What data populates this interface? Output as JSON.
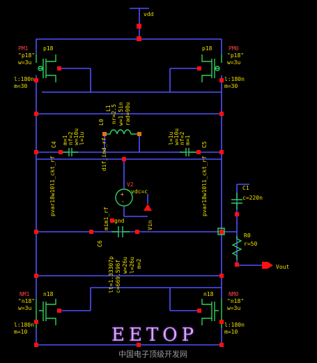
{
  "colors": {
    "background": "#000000",
    "wire": "#5050ff",
    "device": "#30d060",
    "label": "#f0e000",
    "pin": "#ff1010",
    "name": "#ff4040"
  },
  "supply": {
    "net": "vdd"
  },
  "pm1": {
    "name": "PM1",
    "model": "\"p18\"",
    "bulk": "p18",
    "w": "w=3u",
    "l": "l:180n",
    "m": "m=30"
  },
  "pm0": {
    "name": "PM0",
    "model": "\"p18\"",
    "bulk": "p18",
    "w": "w=3u",
    "l": "l:180n",
    "m": "m=30"
  },
  "nm1": {
    "name": "NM1",
    "model": "\"n18\"",
    "bulk": "n18",
    "w": "w=3u",
    "l": "l:180n",
    "m": "m=10"
  },
  "nm0": {
    "name": "NM0",
    "model": "\"n18\"",
    "bulk": "n18",
    "w": "w=3u",
    "l": "l:180n",
    "m": "m=10"
  },
  "l0": {
    "name": "L0",
    "part": "L1",
    "p1": "nr=2.5",
    "p2": "w=1.5in",
    "p3": "rad=90u",
    "model": "dif_ind_rf"
  },
  "c4": {
    "name": "C4",
    "p1": "m=1",
    "p2": "nf=2",
    "p3": "w=10u",
    "p4": "l=1u",
    "model": "pvar18w10l1_ckt_rf"
  },
  "c5": {
    "name": "C5",
    "p1": "l=1u",
    "p2": "w=10u",
    "p3": "nf=2",
    "p4": "m=1",
    "model": "pvar18w10l1_ckt_rf"
  },
  "v2": {
    "name": "V2",
    "value": "vdc=c"
  },
  "c6": {
    "name": "C6",
    "model": "mim1_rf",
    "p1": "lt=1.33307p",
    "p2": "c=669.596f",
    "p3": "w=26u",
    "p4": "l=26u",
    "p5": "m=2"
  },
  "gnd": {
    "label": "gnd"
  },
  "vin": {
    "label": "Vin"
  },
  "c1": {
    "name": "C1",
    "value": "c=220n"
  },
  "r0": {
    "name": "R0",
    "value": "r=50"
  },
  "vout": {
    "label": "Vout"
  },
  "watermark": {
    "text": "EETOP",
    "site": "中国电子顶级开发网"
  }
}
